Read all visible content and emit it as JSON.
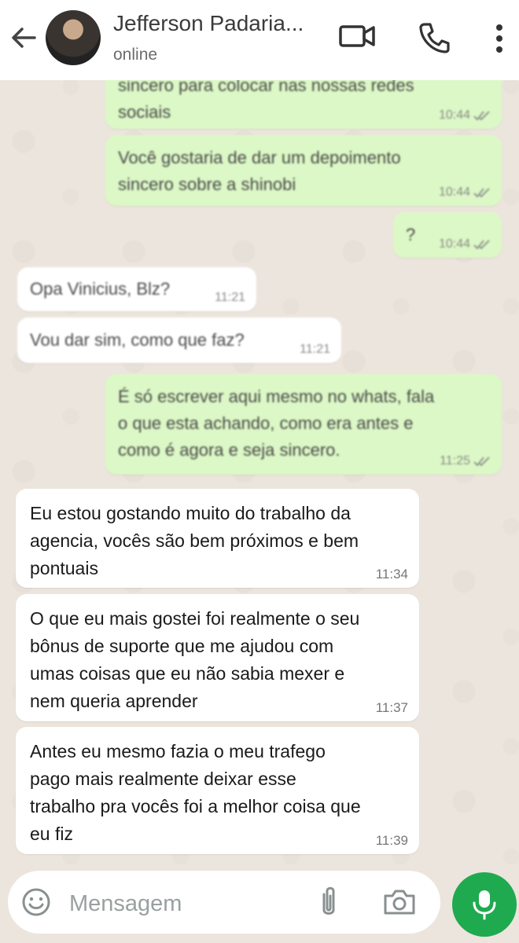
{
  "header": {
    "contact_name": "Jefferson Padaria...",
    "status": "online"
  },
  "messages": [
    {
      "id": "m0",
      "dir": "out",
      "text": "sincero para colocar nas nossas redes\nsociais",
      "time": "10:44",
      "read": true
    },
    {
      "id": "m1",
      "dir": "out",
      "text": "Você gostaria de dar um depoimento\nsincero sobre a shinobi",
      "time": "10:44",
      "read": true
    },
    {
      "id": "m2",
      "dir": "out",
      "text": "?",
      "time": "10:44",
      "read": true
    },
    {
      "id": "m3",
      "dir": "in",
      "text": "Opa Vinicius, Blz?",
      "time": "11:21"
    },
    {
      "id": "m4",
      "dir": "in",
      "text": "Vou dar sim, como que faz?",
      "time": "11:21"
    },
    {
      "id": "m5",
      "dir": "out",
      "text": "É só escrever aqui mesmo no whats, fala\no que esta achando, como era antes e\ncomo é agora e seja sincero.",
      "time": "11:25",
      "read": true
    },
    {
      "id": "m6",
      "dir": "in",
      "text": "Eu estou gostando muito do trabalho da\nagencia, vocês são bem próximos e bem\npontuais",
      "time": "11:34"
    },
    {
      "id": "m7",
      "dir": "in",
      "text": "O que eu mais gostei foi realmente o seu\nbônus de suporte que me ajudou com\numas coisas que eu não sabia mexer e\nnem queria aprender",
      "time": "11:37"
    },
    {
      "id": "m8",
      "dir": "in",
      "text": "Antes eu mesmo fazia o meu trafego\npago mais realmente deixar esse\ntrabalho pra vocês foi a melhor coisa que\neu fiz",
      "time": "11:39"
    }
  ],
  "composer": {
    "placeholder": "Mensagem"
  },
  "icons": [
    "back-arrow-icon",
    "video-call-icon",
    "phone-icon",
    "more-options-icon",
    "emoji-icon",
    "attach-icon",
    "camera-icon",
    "mic-icon",
    "double-check-icon"
  ],
  "colors": {
    "outgoing_bubble": "#dcf8c6",
    "incoming_bubble": "#ffffff",
    "mic_button": "#1faa4f",
    "wallpaper": "#ece5dd"
  }
}
